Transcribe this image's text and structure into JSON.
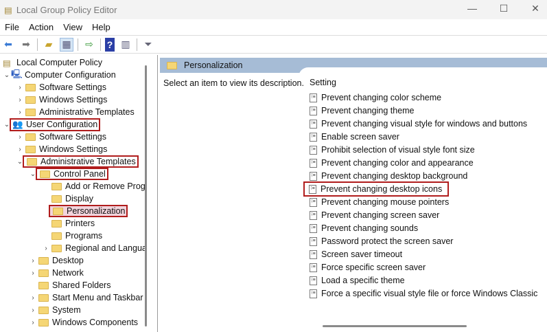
{
  "window": {
    "title": "Local Group Policy Editor",
    "minimize": "—",
    "maximize": "☐",
    "close": "✕"
  },
  "menu": [
    "File",
    "Action",
    "View",
    "Help"
  ],
  "toolbar": [
    "back-icon",
    "forward-icon",
    "up-folder-icon",
    "show-hide-tree-icon",
    "export-list-icon",
    "help-icon",
    "show-action-pane-icon",
    "filter-icon"
  ],
  "tree": [
    {
      "label": "Local Computer Policy",
      "level": 0,
      "icon": "policy",
      "chev": ""
    },
    {
      "label": "Computer Configuration",
      "level": 0,
      "icon": "computer",
      "chev": "v"
    },
    {
      "label": "Software Settings",
      "level": 1,
      "icon": "folder",
      "chev": ">"
    },
    {
      "label": "Windows Settings",
      "level": 1,
      "icon": "folder",
      "chev": ">"
    },
    {
      "label": "Administrative Templates",
      "level": 1,
      "icon": "folder",
      "chev": ">"
    },
    {
      "label": "User Configuration",
      "level": 0,
      "icon": "user",
      "chev": "v",
      "highlight": true
    },
    {
      "label": "Software Settings",
      "level": 1,
      "icon": "folder",
      "chev": ">"
    },
    {
      "label": "Windows Settings",
      "level": 1,
      "icon": "folder",
      "chev": ">"
    },
    {
      "label": "Administrative Templates",
      "level": 1,
      "icon": "folder",
      "chev": "v",
      "highlight": true
    },
    {
      "label": "Control Panel",
      "level": 2,
      "icon": "folder",
      "chev": "v",
      "highlight": true
    },
    {
      "label": "Add or Remove Prog",
      "level": 3,
      "icon": "folder",
      "chev": ""
    },
    {
      "label": "Display",
      "level": 3,
      "icon": "folder",
      "chev": ""
    },
    {
      "label": "Personalization",
      "level": 3,
      "icon": "folder",
      "chev": "",
      "highlight": true,
      "selected": true
    },
    {
      "label": "Printers",
      "level": 3,
      "icon": "folder",
      "chev": ""
    },
    {
      "label": "Programs",
      "level": 3,
      "icon": "folder",
      "chev": ""
    },
    {
      "label": "Regional and Langua",
      "level": 3,
      "icon": "folder",
      "chev": ">"
    },
    {
      "label": "Desktop",
      "level": 2,
      "icon": "folder",
      "chev": ">"
    },
    {
      "label": "Network",
      "level": 2,
      "icon": "folder",
      "chev": ">"
    },
    {
      "label": "Shared Folders",
      "level": 2,
      "icon": "folder",
      "chev": ""
    },
    {
      "label": "Start Menu and Taskbar",
      "level": 2,
      "icon": "folder",
      "chev": ">"
    },
    {
      "label": "System",
      "level": 2,
      "icon": "folder",
      "chev": ">"
    },
    {
      "label": "Windows Components",
      "level": 2,
      "icon": "folder",
      "chev": ">"
    }
  ],
  "right": {
    "header": "Personalization",
    "description": "Select an item to view its description.",
    "column": "Setting",
    "settings": [
      "Prevent changing color scheme",
      "Prevent changing theme",
      "Prevent changing visual style for windows and buttons",
      "Enable screen saver",
      "Prohibit selection of visual style font size",
      "Prevent changing color and appearance",
      "Prevent changing desktop background",
      "Prevent changing desktop icons",
      "Prevent changing mouse pointers",
      "Prevent changing screen saver",
      "Prevent changing sounds",
      "Password protect the screen saver",
      "Screen saver timeout",
      "Force specific screen saver",
      "Load a specific theme",
      "Force a specific visual style file or force Windows Classic"
    ],
    "highlighted_index": 7
  }
}
